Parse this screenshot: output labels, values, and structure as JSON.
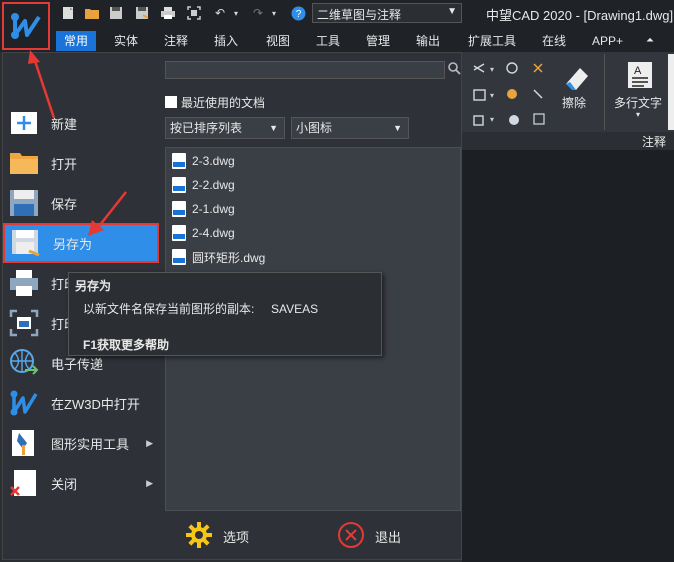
{
  "titlebar": {
    "workspace": "二维草图与注释",
    "window_title": "中望CAD 2020 - [Drawing1.dwg]"
  },
  "ribbon": {
    "tabs": [
      "常用",
      "实体",
      "注释",
      "插入",
      "视图",
      "工具",
      "管理",
      "输出",
      "扩展工具",
      "在线",
      "APP+"
    ],
    "active_tab": 0,
    "erase_label": "擦除",
    "mtext_label": "多行文字",
    "group_label": "注释"
  },
  "menu": {
    "items": [
      {
        "label": "新建",
        "icon": "new-icon"
      },
      {
        "label": "打开",
        "icon": "open-folder-icon"
      },
      {
        "label": "保存",
        "icon": "save-icon"
      },
      {
        "label": "另存为",
        "icon": "save-as-icon"
      },
      {
        "label": "打印",
        "icon": "print-icon"
      },
      {
        "label": "打印",
        "icon": "print-preview-icon"
      },
      {
        "label": "电子传递",
        "icon": "etransmit-icon"
      },
      {
        "label": "在ZW3D中打开",
        "icon": "zw3d-icon"
      },
      {
        "label": "图形实用工具",
        "icon": "drawing-utilities-icon"
      },
      {
        "label": "关闭",
        "icon": "close-doc-icon"
      }
    ],
    "recent_title": "最近使用的文档",
    "sort_option": "按已排序列表",
    "view_option": "小图标",
    "files": [
      "2-3.dwg",
      "2-2.dwg",
      "2-1.dwg",
      "2-4.dwg",
      "圆环矩形.dwg"
    ],
    "options_label": "选项",
    "exit_label": "退出"
  },
  "tooltip": {
    "title": "另存为",
    "description": "以新文件名保存当前图形的副本:     SAVEAS",
    "help": "F1获取更多帮助"
  },
  "colors": {
    "accent": "#2f8fe8",
    "highlight_border": "#e53935",
    "background": "#2e3238"
  }
}
